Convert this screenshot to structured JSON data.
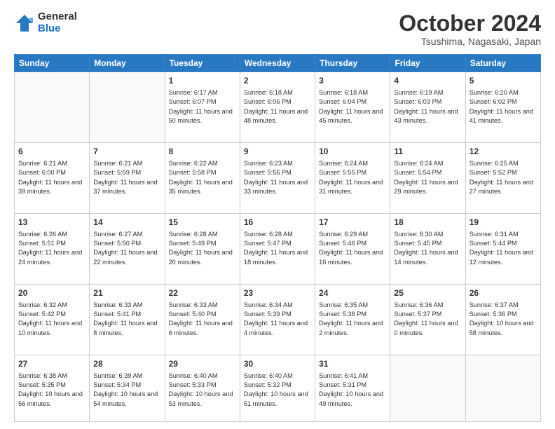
{
  "logo": {
    "general": "General",
    "blue": "Blue"
  },
  "title": "October 2024",
  "subtitle": "Tsushima, Nagasaki, Japan",
  "days_of_week": [
    "Sunday",
    "Monday",
    "Tuesday",
    "Wednesday",
    "Thursday",
    "Friday",
    "Saturday"
  ],
  "weeks": [
    [
      {
        "day": "",
        "content": ""
      },
      {
        "day": "",
        "content": ""
      },
      {
        "day": "1",
        "content": "Sunrise: 6:17 AM\nSunset: 6:07 PM\nDaylight: 11 hours and 50 minutes."
      },
      {
        "day": "2",
        "content": "Sunrise: 6:18 AM\nSunset: 6:06 PM\nDaylight: 11 hours and 48 minutes."
      },
      {
        "day": "3",
        "content": "Sunrise: 6:18 AM\nSunset: 6:04 PM\nDaylight: 11 hours and 45 minutes."
      },
      {
        "day": "4",
        "content": "Sunrise: 6:19 AM\nSunset: 6:03 PM\nDaylight: 11 hours and 43 minutes."
      },
      {
        "day": "5",
        "content": "Sunrise: 6:20 AM\nSunset: 6:02 PM\nDaylight: 11 hours and 41 minutes."
      }
    ],
    [
      {
        "day": "6",
        "content": "Sunrise: 6:21 AM\nSunset: 6:00 PM\nDaylight: 11 hours and 39 minutes."
      },
      {
        "day": "7",
        "content": "Sunrise: 6:21 AM\nSunset: 5:59 PM\nDaylight: 11 hours and 37 minutes."
      },
      {
        "day": "8",
        "content": "Sunrise: 6:22 AM\nSunset: 5:58 PM\nDaylight: 11 hours and 35 minutes."
      },
      {
        "day": "9",
        "content": "Sunrise: 6:23 AM\nSunset: 5:56 PM\nDaylight: 11 hours and 33 minutes."
      },
      {
        "day": "10",
        "content": "Sunrise: 6:24 AM\nSunset: 5:55 PM\nDaylight: 11 hours and 31 minutes."
      },
      {
        "day": "11",
        "content": "Sunrise: 6:24 AM\nSunset: 5:54 PM\nDaylight: 11 hours and 29 minutes."
      },
      {
        "day": "12",
        "content": "Sunrise: 6:25 AM\nSunset: 5:52 PM\nDaylight: 11 hours and 27 minutes."
      }
    ],
    [
      {
        "day": "13",
        "content": "Sunrise: 6:26 AM\nSunset: 5:51 PM\nDaylight: 11 hours and 24 minutes."
      },
      {
        "day": "14",
        "content": "Sunrise: 6:27 AM\nSunset: 5:50 PM\nDaylight: 11 hours and 22 minutes."
      },
      {
        "day": "15",
        "content": "Sunrise: 6:28 AM\nSunset: 5:49 PM\nDaylight: 11 hours and 20 minutes."
      },
      {
        "day": "16",
        "content": "Sunrise: 6:28 AM\nSunset: 5:47 PM\nDaylight: 11 hours and 18 minutes."
      },
      {
        "day": "17",
        "content": "Sunrise: 6:29 AM\nSunset: 5:46 PM\nDaylight: 11 hours and 16 minutes."
      },
      {
        "day": "18",
        "content": "Sunrise: 6:30 AM\nSunset: 5:45 PM\nDaylight: 11 hours and 14 minutes."
      },
      {
        "day": "19",
        "content": "Sunrise: 6:31 AM\nSunset: 5:44 PM\nDaylight: 11 hours and 12 minutes."
      }
    ],
    [
      {
        "day": "20",
        "content": "Sunrise: 6:32 AM\nSunset: 5:42 PM\nDaylight: 11 hours and 10 minutes."
      },
      {
        "day": "21",
        "content": "Sunrise: 6:33 AM\nSunset: 5:41 PM\nDaylight: 11 hours and 8 minutes."
      },
      {
        "day": "22",
        "content": "Sunrise: 6:33 AM\nSunset: 5:40 PM\nDaylight: 11 hours and 6 minutes."
      },
      {
        "day": "23",
        "content": "Sunrise: 6:34 AM\nSunset: 5:39 PM\nDaylight: 11 hours and 4 minutes."
      },
      {
        "day": "24",
        "content": "Sunrise: 6:35 AM\nSunset: 5:38 PM\nDaylight: 11 hours and 2 minutes."
      },
      {
        "day": "25",
        "content": "Sunrise: 6:36 AM\nSunset: 5:37 PM\nDaylight: 11 hours and 0 minutes."
      },
      {
        "day": "26",
        "content": "Sunrise: 6:37 AM\nSunset: 5:36 PM\nDaylight: 10 hours and 58 minutes."
      }
    ],
    [
      {
        "day": "27",
        "content": "Sunrise: 6:38 AM\nSunset: 5:35 PM\nDaylight: 10 hours and 56 minutes."
      },
      {
        "day": "28",
        "content": "Sunrise: 6:39 AM\nSunset: 5:34 PM\nDaylight: 10 hours and 54 minutes."
      },
      {
        "day": "29",
        "content": "Sunrise: 6:40 AM\nSunset: 5:33 PM\nDaylight: 10 hours and 53 minutes."
      },
      {
        "day": "30",
        "content": "Sunrise: 6:40 AM\nSunset: 5:32 PM\nDaylight: 10 hours and 51 minutes."
      },
      {
        "day": "31",
        "content": "Sunrise: 6:41 AM\nSunset: 5:31 PM\nDaylight: 10 hours and 49 minutes."
      },
      {
        "day": "",
        "content": ""
      },
      {
        "day": "",
        "content": ""
      }
    ]
  ]
}
